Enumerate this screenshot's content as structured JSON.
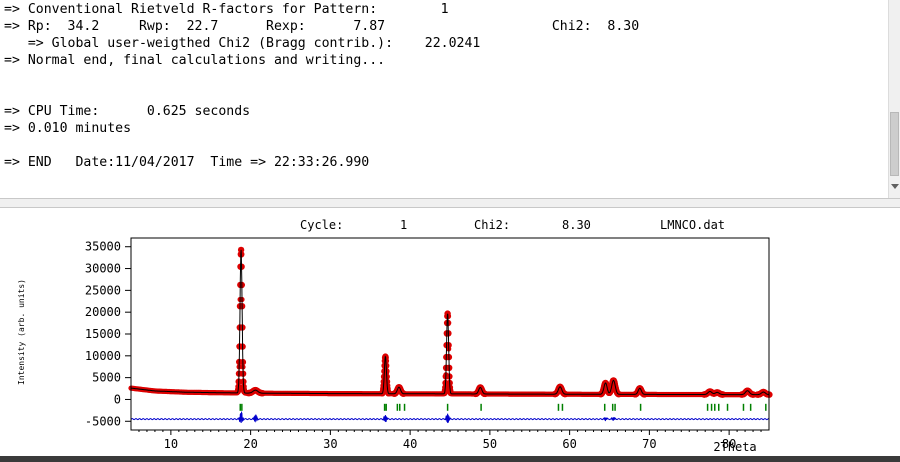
{
  "console": {
    "lines": [
      "=> Conventional Rietveld R-factors for Pattern:        1",
      "=> Rp:  34.2     Rwp:  22.7      Rexp:      7.87                     Chi2:  8.30",
      "   => Global user-weigthed Chi2 (Bragg contrib.):    22.0241",
      "=> Normal end, final calculations and writing...",
      "",
      "",
      "=> CPU Time:      0.625 seconds",
      "=> 0.010 minutes",
      "",
      "=> END   Date:11/04/2017  Time => 22:33:26.990"
    ]
  },
  "plot_header": {
    "cycle_label": "Cycle:",
    "cycle_value": "1",
    "chi2_label": "Chi2:",
    "chi2_value": "8.30",
    "filename": "LMNCO.dat"
  },
  "chart_data": {
    "type": "scatter",
    "ylabel": "Intensity (arb. units)",
    "xlabel": "2Theta",
    "xlim": [
      5,
      85
    ],
    "ylim": [
      -7000,
      37000
    ],
    "x_ticks": [
      10,
      20,
      30,
      40,
      50,
      60,
      70,
      80
    ],
    "y_ticks": [
      35000,
      30000,
      25000,
      20000,
      15000,
      10000,
      5000,
      0,
      -5000
    ],
    "series_colors": {
      "observed": "#dd0000",
      "calculated": "#000000",
      "difference": "#0000cc",
      "bragg": "#008000"
    },
    "background": [
      [
        5,
        2600
      ],
      [
        8,
        1950
      ],
      [
        12,
        1650
      ],
      [
        20,
        1450
      ],
      [
        30,
        1350
      ],
      [
        40,
        1300
      ],
      [
        50,
        1250
      ],
      [
        60,
        1200
      ],
      [
        70,
        1150
      ],
      [
        85,
        1100
      ]
    ],
    "peaks": [
      {
        "pos": 18.8,
        "height": 32800,
        "width": 0.13
      },
      {
        "pos": 20.6,
        "height": 700,
        "width": 0.3
      },
      {
        "pos": 36.9,
        "height": 8500,
        "width": 0.13
      },
      {
        "pos": 38.6,
        "height": 1500,
        "width": 0.2
      },
      {
        "pos": 44.7,
        "height": 18400,
        "width": 0.13
      },
      {
        "pos": 48.8,
        "height": 1500,
        "width": 0.2
      },
      {
        "pos": 58.8,
        "height": 1700,
        "width": 0.22
      },
      {
        "pos": 64.5,
        "height": 2600,
        "width": 0.2
      },
      {
        "pos": 65.5,
        "height": 3200,
        "width": 0.22
      },
      {
        "pos": 68.8,
        "height": 1400,
        "width": 0.2
      },
      {
        "pos": 77.6,
        "height": 700,
        "width": 0.25
      },
      {
        "pos": 78.5,
        "height": 500,
        "width": 0.25
      },
      {
        "pos": 82.3,
        "height": 900,
        "width": 0.25
      },
      {
        "pos": 84.3,
        "height": 600,
        "width": 0.25
      }
    ],
    "difference_offset": -4500,
    "difference_spikes": [
      {
        "pos": 18.8,
        "value": 1500
      },
      {
        "pos": 20.6,
        "value": 900
      },
      {
        "pos": 36.9,
        "value": 900
      },
      {
        "pos": 44.7,
        "value": 1200
      },
      {
        "pos": 64.5,
        "value": 400
      },
      {
        "pos": 65.5,
        "value": 400
      }
    ],
    "bragg_positions": [
      18.7,
      18.9,
      36.8,
      37.0,
      38.4,
      38.7,
      39.3,
      44.7,
      48.9,
      58.6,
      59.1,
      64.4,
      65.4,
      65.7,
      68.9,
      77.3,
      77.8,
      78.2,
      78.7,
      79.8,
      81.8,
      82.7,
      84.6
    ]
  }
}
